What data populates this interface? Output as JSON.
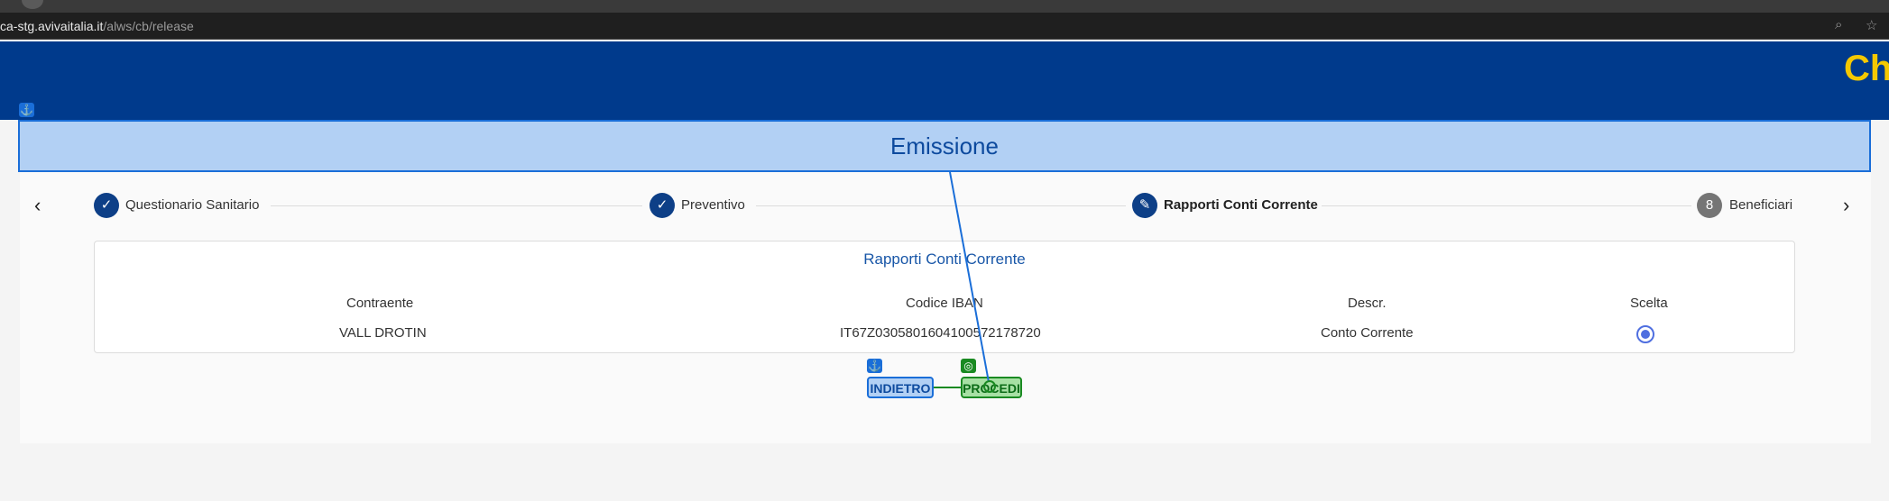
{
  "browser": {
    "url_host": "ca-stg.avivaitalia.it",
    "url_path": "/alws/cb/release",
    "zoom_icon": "zoom-icon",
    "bookmark_icon": "star-icon"
  },
  "header": {
    "brand_text": "Ch"
  },
  "section": {
    "title": "Emissione"
  },
  "stepper": {
    "steps": [
      {
        "number": "",
        "label": "Questionario Sanitario",
        "state": "completed"
      },
      {
        "number": "",
        "label": "Preventivo",
        "state": "completed"
      },
      {
        "number": "",
        "label": "Rapporti Conti Corrente",
        "state": "active"
      },
      {
        "number": "8",
        "label": "Beneficiari",
        "state": "pending"
      }
    ]
  },
  "card": {
    "title": "Rapporti Conti Corrente",
    "columns": [
      "Contraente",
      "Codice IBAN",
      "Descr.",
      "Scelta"
    ],
    "rows": [
      {
        "contraente": "VALL DROTIN",
        "iban": "IT67Z0305801604100572178720",
        "descr": "Conto Corrente",
        "selected": true
      }
    ]
  },
  "actions": {
    "back_label": "INDIETRO",
    "next_label": "PROCEDI"
  },
  "colors": {
    "header_bg": "#003a8c",
    "brand_yellow": "#f5c800",
    "step_done": "#0d3f87",
    "annotation_blue": "#1a6ed8",
    "annotation_green": "#1a8a22"
  }
}
